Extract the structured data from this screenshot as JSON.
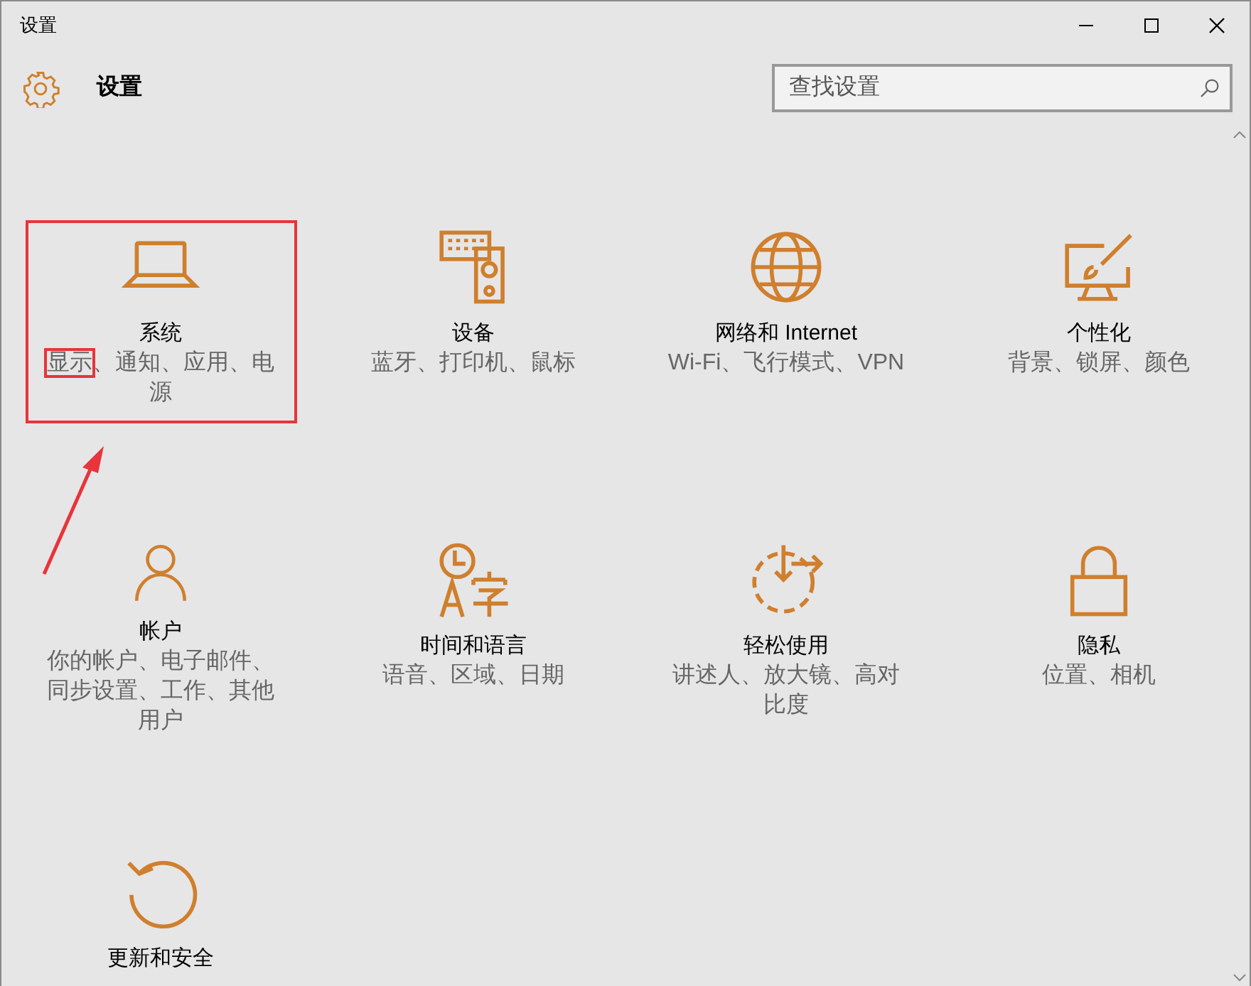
{
  "window": {
    "title": "设置"
  },
  "header": {
    "title": "设置"
  },
  "search": {
    "placeholder": "查找设置"
  },
  "tiles": [
    {
      "title": "系统",
      "subtitle": [
        {
          "text": "显示",
          "boxed": true
        },
        {
          "text": "、通知、应用、电源",
          "boxed": false
        }
      ],
      "highlighted": true
    },
    {
      "title": "设备",
      "subtitle": [
        {
          "text": "蓝牙、打印机、鼠标",
          "boxed": false
        }
      ],
      "highlighted": false
    },
    {
      "title": "网络和 Internet",
      "subtitle": [
        {
          "text": "Wi-Fi、飞行模式、VPN",
          "boxed": false
        }
      ],
      "highlighted": false
    },
    {
      "title": "个性化",
      "subtitle": [
        {
          "text": "背景、锁屏、颜色",
          "boxed": false
        }
      ],
      "highlighted": false
    },
    {
      "title": "帐户",
      "subtitle": [
        {
          "text": "你的帐户、电子邮件、同步设置、工作、其他用户",
          "boxed": false
        }
      ],
      "highlighted": false
    },
    {
      "title": "时间和语言",
      "subtitle": [
        {
          "text": "语音、区域、日期",
          "boxed": false
        }
      ],
      "highlighted": false
    },
    {
      "title": "轻松使用",
      "subtitle": [
        {
          "text": "讲述人、放大镜、高对比度",
          "boxed": false
        }
      ],
      "highlighted": false
    },
    {
      "title": "隐私",
      "subtitle": [
        {
          "text": "位置、相机",
          "boxed": false
        }
      ],
      "highlighted": false
    },
    {
      "title": "更新和安全",
      "highlighted": false
    }
  ]
}
